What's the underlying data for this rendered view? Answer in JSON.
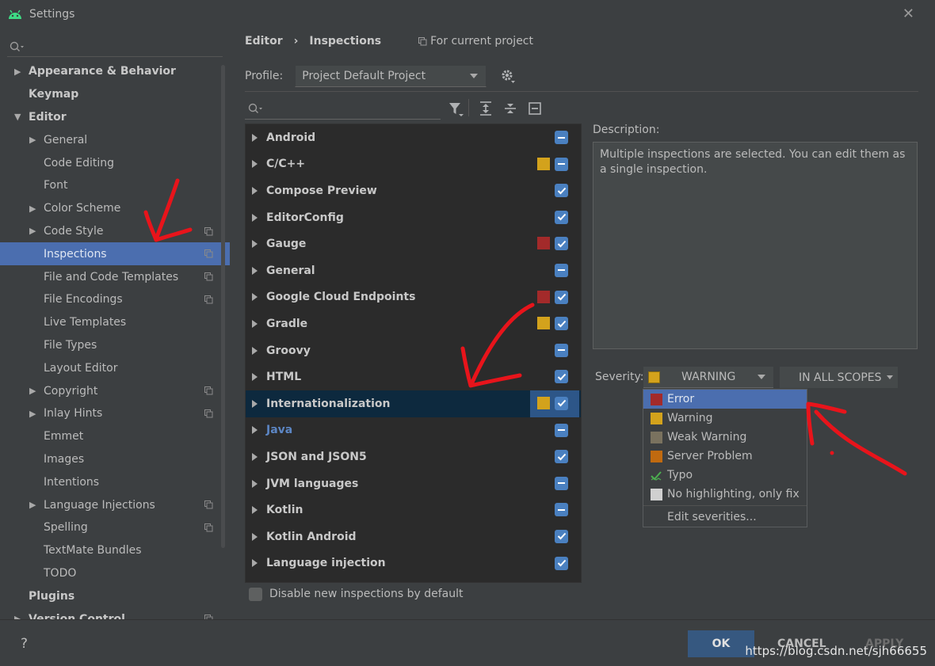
{
  "window": {
    "title": "Settings"
  },
  "sidebar": {
    "items": [
      {
        "label": "Appearance & Behavior",
        "level": 0,
        "arrow": "right",
        "bold": true
      },
      {
        "label": "Keymap",
        "level": 0,
        "arrow": "none",
        "bold": true
      },
      {
        "label": "Editor",
        "level": 0,
        "arrow": "down",
        "bold": true
      },
      {
        "label": "General",
        "level": 1,
        "arrow": "right"
      },
      {
        "label": "Code Editing",
        "level": 1,
        "arrow": "none"
      },
      {
        "label": "Font",
        "level": 1,
        "arrow": "none"
      },
      {
        "label": "Color Scheme",
        "level": 1,
        "arrow": "right"
      },
      {
        "label": "Code Style",
        "level": 1,
        "arrow": "right",
        "copy": true
      },
      {
        "label": "Inspections",
        "level": 1,
        "arrow": "none",
        "copy": true,
        "selected": true
      },
      {
        "label": "File and Code Templates",
        "level": 1,
        "arrow": "none",
        "copy": true
      },
      {
        "label": "File Encodings",
        "level": 1,
        "arrow": "none",
        "copy": true
      },
      {
        "label": "Live Templates",
        "level": 1,
        "arrow": "none"
      },
      {
        "label": "File Types",
        "level": 1,
        "arrow": "none"
      },
      {
        "label": "Layout Editor",
        "level": 1,
        "arrow": "none"
      },
      {
        "label": "Copyright",
        "level": 1,
        "arrow": "right",
        "copy": true
      },
      {
        "label": "Inlay Hints",
        "level": 1,
        "arrow": "right",
        "copy": true
      },
      {
        "label": "Emmet",
        "level": 1,
        "arrow": "none"
      },
      {
        "label": "Images",
        "level": 1,
        "arrow": "none"
      },
      {
        "label": "Intentions",
        "level": 1,
        "arrow": "none"
      },
      {
        "label": "Language Injections",
        "level": 1,
        "arrow": "right",
        "copy": true
      },
      {
        "label": "Spelling",
        "level": 1,
        "arrow": "none",
        "copy": true
      },
      {
        "label": "TextMate Bundles",
        "level": 1,
        "arrow": "none"
      },
      {
        "label": "TODO",
        "level": 1,
        "arrow": "none"
      },
      {
        "label": "Plugins",
        "level": 0,
        "arrow": "none",
        "bold": true
      },
      {
        "label": "Version Control",
        "level": 0,
        "arrow": "right",
        "bold": true,
        "copy": true
      }
    ]
  },
  "breadcrumb": {
    "parent": "Editor",
    "separator": "›",
    "current": "Inspections",
    "scope": "For current project"
  },
  "profile": {
    "label": "Profile:",
    "value": "Project Default  Project"
  },
  "inspections": [
    {
      "label": "Android",
      "color": "",
      "check": "partial"
    },
    {
      "label": "C/C++",
      "color": "#d3a21c",
      "check": "partial"
    },
    {
      "label": "Compose Preview",
      "color": "",
      "check": "checked"
    },
    {
      "label": "EditorConfig",
      "color": "",
      "check": "checked"
    },
    {
      "label": "Gauge",
      "color": "#a32a2a",
      "check": "checked"
    },
    {
      "label": "General",
      "color": "",
      "check": "partial"
    },
    {
      "label": "Google Cloud Endpoints",
      "color": "#a32a2a",
      "check": "checked"
    },
    {
      "label": "Gradle",
      "color": "#d3a21c",
      "check": "checked"
    },
    {
      "label": "Groovy",
      "color": "",
      "check": "partial"
    },
    {
      "label": "HTML",
      "color": "",
      "check": "checked"
    },
    {
      "label": "Internationalization",
      "color": "#d3a21c",
      "check": "checked",
      "selected": true
    },
    {
      "label": "Java",
      "color": "",
      "check": "partial",
      "link": true
    },
    {
      "label": "JSON and JSON5",
      "color": "",
      "check": "checked"
    },
    {
      "label": "JVM languages",
      "color": "",
      "check": "partial"
    },
    {
      "label": "Kotlin",
      "color": "",
      "check": "partial"
    },
    {
      "label": "Kotlin Android",
      "color": "",
      "check": "checked"
    },
    {
      "label": "Language injection",
      "color": "",
      "check": "checked"
    }
  ],
  "disable_new": {
    "label": "Disable new inspections by default"
  },
  "description": {
    "label": "Description:",
    "text": "Multiple inspections are selected. You can edit them as a single inspection."
  },
  "severity": {
    "label": "Severity:",
    "value": "WARNING",
    "scope": "IN ALL SCOPES",
    "options": [
      {
        "label": "Error",
        "color": "#a32a2a",
        "selected": true
      },
      {
        "label": "Warning",
        "color": "#d3a21c"
      },
      {
        "label": "Weak Warning",
        "color": "#7a725f"
      },
      {
        "label": "Server Problem",
        "color": "#c06a10"
      },
      {
        "label": "Typo",
        "color": "typo"
      },
      {
        "label": "No highlighting, only fix",
        "color": "#d0d0d0"
      },
      {
        "label": "Edit severities...",
        "color": ""
      }
    ]
  },
  "buttons": {
    "help": "?",
    "ok": "OK",
    "cancel": "CANCEL",
    "apply": "APPLY"
  },
  "watermark": "https://blog.csdn.net/sjh66655"
}
